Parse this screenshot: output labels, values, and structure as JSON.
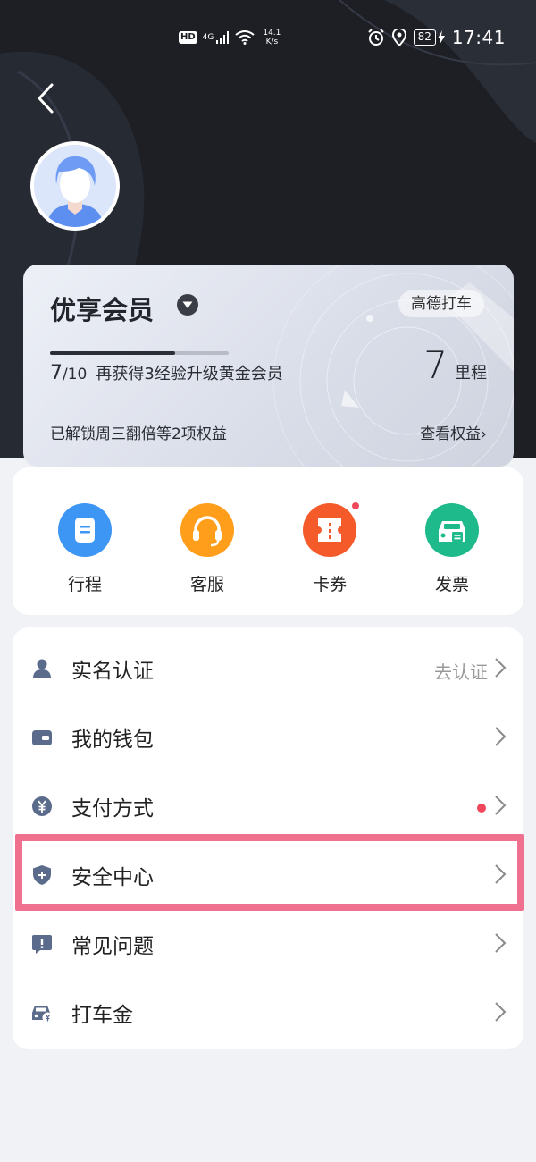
{
  "status_bar": {
    "hd": "HD",
    "network": "4G",
    "speed_value": "14.1",
    "speed_unit": "K/s",
    "battery": "82",
    "time": "17:41"
  },
  "member": {
    "title": "优享会员",
    "platform_tag": "高德打车",
    "progress_current": "7",
    "progress_total": "/10",
    "progress_fraction": 0.7,
    "progress_text": "再获得3经验升级黄金会员",
    "miles_value": "7",
    "miles_unit": "里程",
    "benefit_text": "已解锁周三翻倍等2项权益",
    "view_benefits": "查看权益›"
  },
  "quick_actions": [
    {
      "label": "行程",
      "icon": "trip-icon",
      "color": "#3d95f4"
    },
    {
      "label": "客服",
      "icon": "headset-icon",
      "color": "#ff9e1b"
    },
    {
      "label": "卡券",
      "icon": "coupon-icon",
      "color": "#f55a2b",
      "badge": true
    },
    {
      "label": "发票",
      "icon": "invoice-car-icon",
      "color": "#1fba8c"
    }
  ],
  "menu": {
    "items": [
      {
        "label": "实名认证",
        "icon": "person-icon",
        "right_text": "去认证"
      },
      {
        "label": "我的钱包",
        "icon": "wallet-icon",
        "right_text": ""
      },
      {
        "label": "支付方式",
        "icon": "yuan-icon",
        "right_text": "",
        "badge": true
      },
      {
        "label": "安全中心",
        "icon": "shield-icon",
        "right_text": ""
      },
      {
        "label": "常见问题",
        "icon": "question-icon",
        "right_text": ""
      },
      {
        "label": "打车金",
        "icon": "car-yuan-icon",
        "right_text": ""
      }
    ]
  },
  "colors": {
    "header_bg": "#1d1f25",
    "page_bg": "#f1f2f6",
    "menu_icon": "#5b6b8c",
    "badge_red": "#f0485a",
    "highlight": "#f0708f"
  }
}
